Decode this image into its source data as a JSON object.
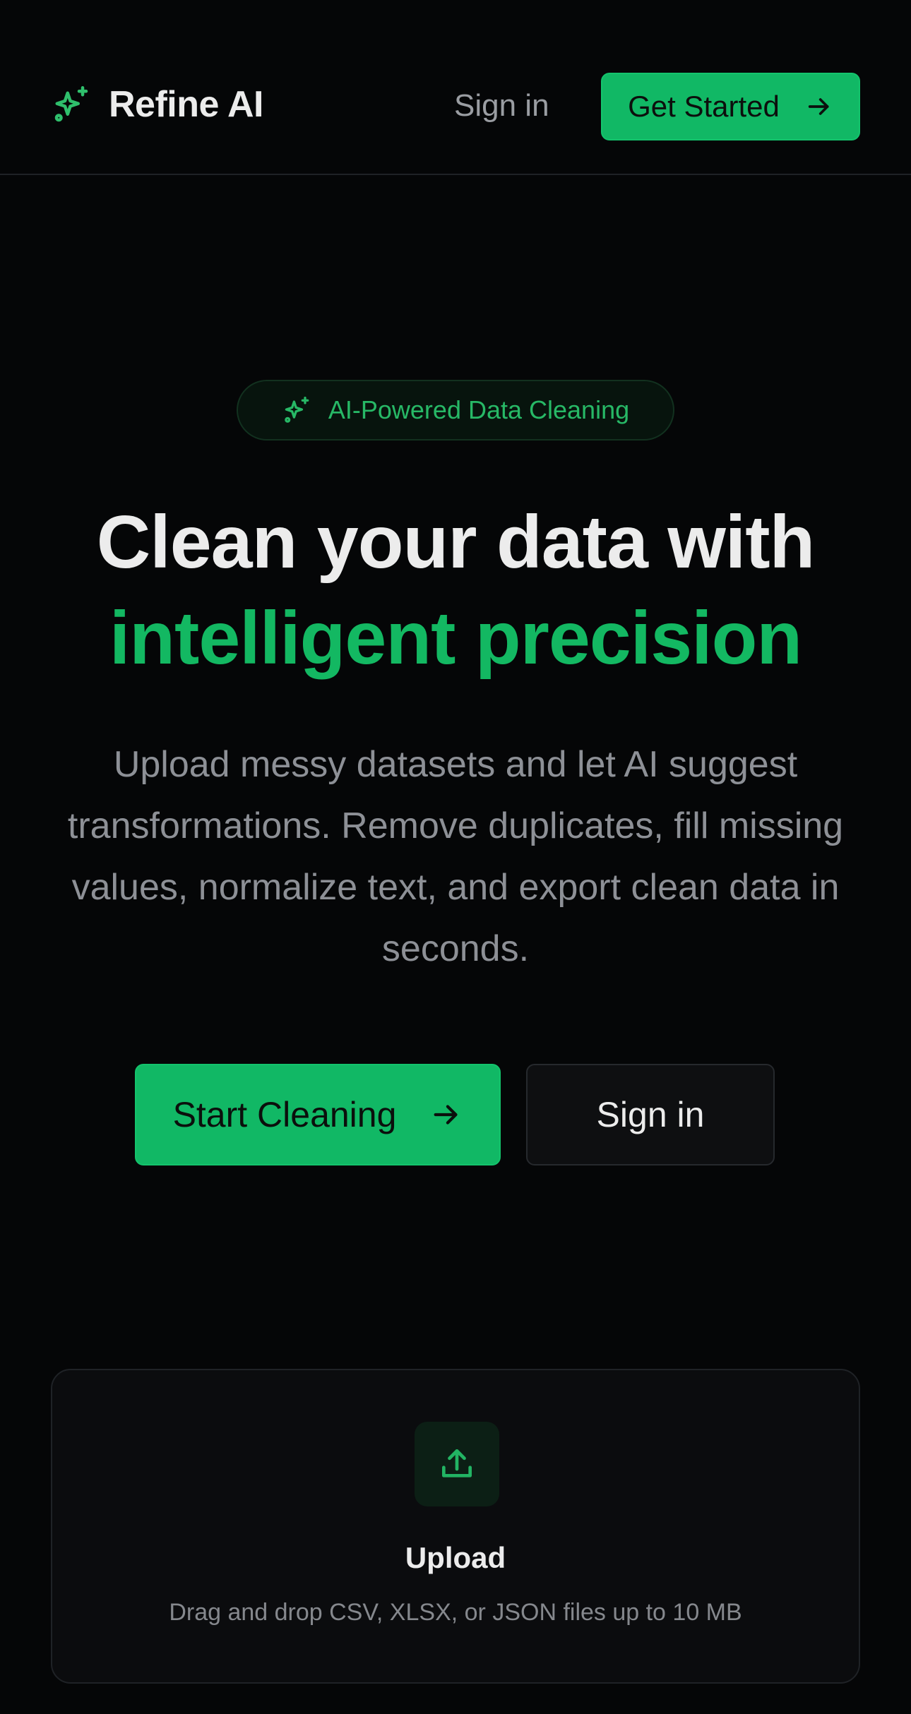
{
  "header": {
    "brand_name": "Refine AI",
    "brand_icon": "sparkles-icon",
    "sign_in_label": "Sign in",
    "get_started_label": "Get Started",
    "get_started_icon": "arrow-right-icon"
  },
  "hero": {
    "badge_label": "AI-Powered Data Cleaning",
    "badge_icon": "sparkles-icon",
    "headline_line1": "Clean your data with",
    "headline_line2": "intelligent precision",
    "subtext": "Upload messy datasets and let AI suggest transformations. Remove duplicates, fill missing values, normalize text, and export clean data in seconds.",
    "primary_cta_label": "Start Cleaning",
    "secondary_cta_label": "Sign in"
  },
  "upload": {
    "icon": "upload-icon",
    "title": "Upload",
    "description": "Drag and drop CSV, XLSX, or JSON files up to 10 MB"
  },
  "colors": {
    "background": "#050607",
    "accent": "#11b865",
    "accent_text": "#13b862",
    "muted_text": "#8d9096",
    "border": "#1f2226"
  }
}
